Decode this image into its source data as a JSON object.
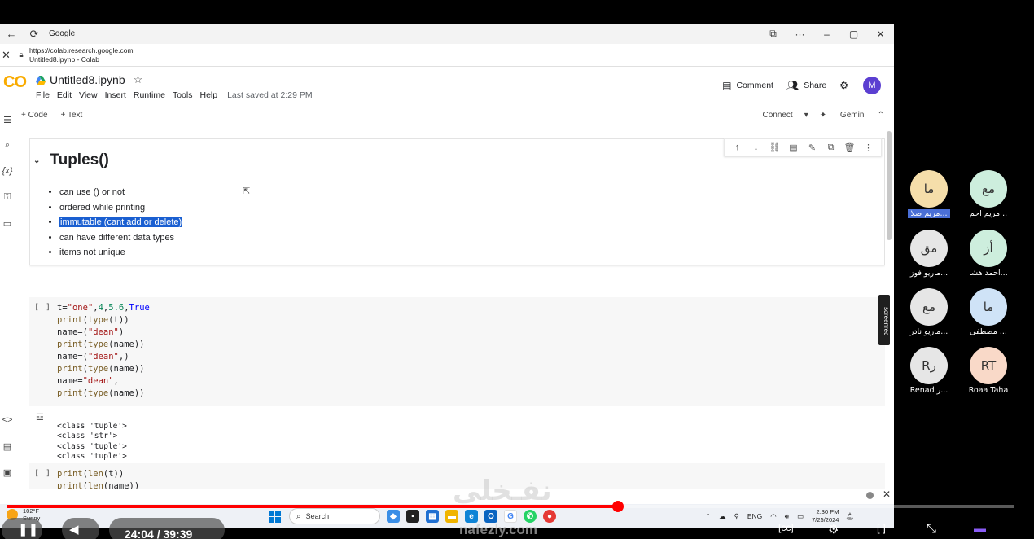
{
  "browser": {
    "title": "Google",
    "url": "https://colab.research.google.com",
    "page_title": "Untitled8.ipynb - Colab"
  },
  "colab": {
    "logo": "CO",
    "notebook_name": "Untitled8.ipynb",
    "menu": [
      "File",
      "Edit",
      "View",
      "Insert",
      "Runtime",
      "Tools",
      "Help"
    ],
    "last_saved": "Last saved at 2:29 PM",
    "comment_label": "Comment",
    "share_label": "Share",
    "avatar_letter": "M",
    "add_code": "+ Code",
    "add_text": "+ Text",
    "connect_label": "Connect",
    "gemini_label": "Gemini"
  },
  "text_cell": {
    "heading": "Tuples()",
    "bullets": [
      "can use () or not",
      "ordered while printing",
      "immutable (cant add or delete)",
      "can have different data types",
      "items not unique"
    ]
  },
  "code_cell_1": {
    "run_label": "[ ]",
    "output": [
      "<class 'tuple'>",
      "<class 'str'>",
      "<class 'tuple'>",
      "<class 'tuple'>"
    ]
  },
  "code_cell_2": {
    "run_label": "[ ]"
  },
  "participants": [
    {
      "initials": "ما",
      "name": "مريم صلا...",
      "color": "#f5deaa",
      "selected": true
    },
    {
      "initials": "مع",
      "name": "مريم احم...",
      "color": "#cdeedd",
      "selected": false
    },
    {
      "initials": "مق",
      "name": "ماريو فوز...",
      "color": "#e6e6e6",
      "selected": false
    },
    {
      "initials": "أز",
      "name": "احمد هشا...",
      "color": "#cdeedd",
      "selected": false
    },
    {
      "initials": "مع",
      "name": "ماريو نادر...",
      "color": "#e6e6e6",
      "selected": false
    },
    {
      "initials": "ما",
      "name": "مصطفى ...",
      "color": "#cfe3f7",
      "selected": false
    },
    {
      "initials": "Rر",
      "name": "Renad ر...",
      "color": "#e6e6e6",
      "selected": false
    },
    {
      "initials": "RT",
      "name": "Roaa Taha",
      "color": "#f9d9c8",
      "selected": false
    }
  ],
  "screenrec_label": "screenrec",
  "taskbar": {
    "weather_temp": "102°F",
    "weather_desc": "Sunny",
    "search_placeholder": "Search",
    "lang": "ENG",
    "time": "2:30 PM",
    "date": "7/25/2024"
  },
  "video": {
    "timecode": "24:04 / 39:39",
    "progress": 0.607,
    "watermark": "نفـخلي",
    "watermark_url": "nafezly.com"
  }
}
